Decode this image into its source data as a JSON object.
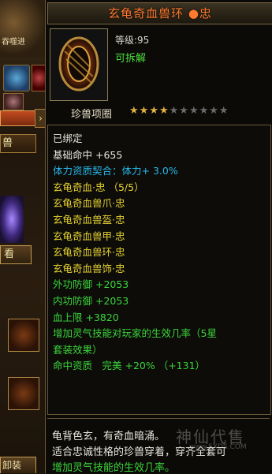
{
  "left_panel": {
    "banner_text": "吞噬进",
    "tab_label": "兽",
    "view_button": "看",
    "unequip_button": "卸装"
  },
  "tooltip": {
    "title": "玄龟奇血兽环 ●忠",
    "level": "等级:95",
    "disassemble": "可拆解",
    "collar_label": "珍兽项圈",
    "collar_stars_filled": 4,
    "collar_stars_total": 10,
    "stats": [
      {
        "text": "已绑定",
        "color": "white"
      },
      {
        "text": "基础命中 +655",
        "color": "white"
      },
      {
        "text": "体力资质契合：体力+ 3.0%",
        "color": "blue"
      },
      {
        "text": "玄龟奇血·忠 （5/5）",
        "color": "yellow"
      },
      {
        "text": "玄龟奇血兽爪·忠",
        "color": "yellow"
      },
      {
        "text": "玄龟奇血兽盔·忠",
        "color": "yellow"
      },
      {
        "text": "玄龟奇血兽甲·忠",
        "color": "yellow"
      },
      {
        "text": "玄龟奇血兽环·忠",
        "color": "yellow"
      },
      {
        "text": "玄龟奇血兽饰·忠",
        "color": "yellow"
      },
      {
        "text": "外功防御 +2053",
        "color": "green"
      },
      {
        "text": "内功防御 +2053",
        "color": "green"
      },
      {
        "text": "血上限 +3820",
        "color": "green"
      },
      {
        "text": "增加灵气技能对玩家的生效几率（5星",
        "color": "green"
      },
      {
        "text": "套装效果）",
        "color": "green"
      },
      {
        "text": "命中资质　完美 +20% （+131）",
        "color": "green"
      }
    ],
    "description": [
      {
        "text": "龟背色玄，有奇血暗涌。",
        "color": "white"
      },
      {
        "text": "适合忠诚性格的珍兽穿着，穿齐全套可",
        "color": "white"
      },
      {
        "text": "增加灵气技能的生效几率。",
        "color": "green"
      }
    ],
    "watermark": "神仙代售",
    "watermark_url": "www.SXDS.COM"
  },
  "colors": {
    "title": "#ff7a2e",
    "white": "#e8e6dc",
    "blue": "#27b8ea",
    "green": "#3bd43b",
    "yellow": "#e7d230"
  }
}
